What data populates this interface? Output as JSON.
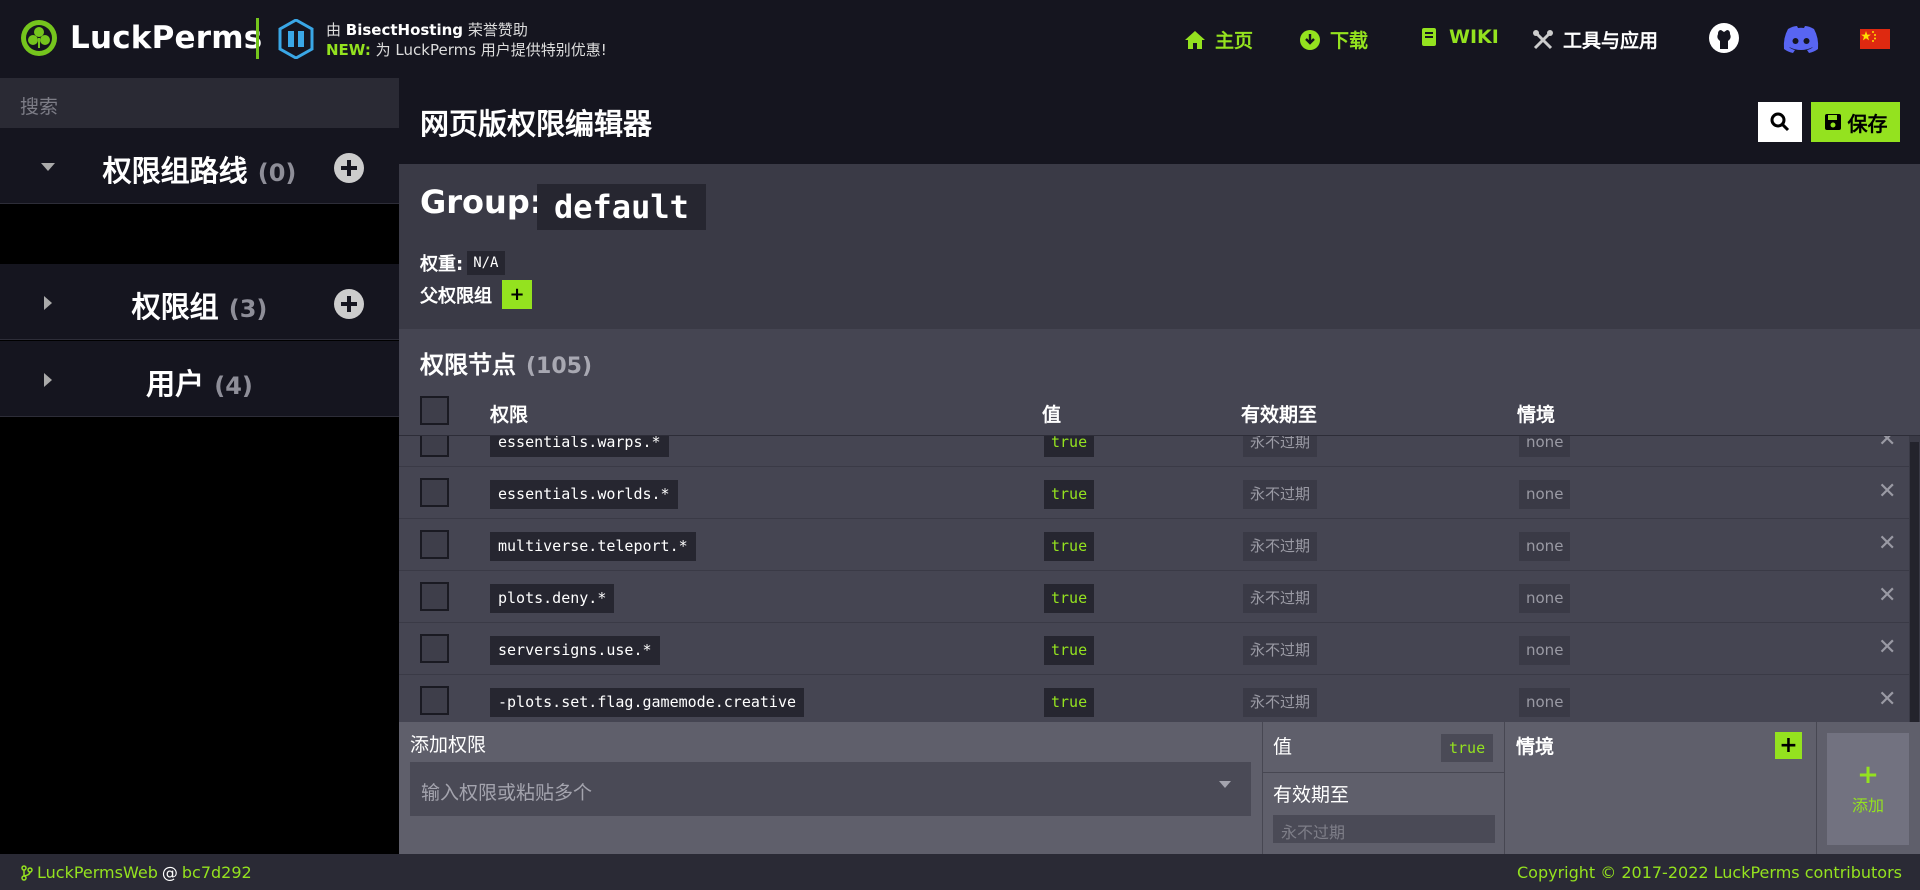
{
  "header": {
    "brand": "LuckPerms",
    "sponsor_prefix": "由 ",
    "sponsor_name": "BisectHosting",
    "sponsor_suffix": " 荣誉赞助",
    "sponsor_new_tag": "NEW:",
    "sponsor_new_text": " 为 LuckPerms 用户提供特别优惠!",
    "nav": {
      "home": "主页",
      "download": "下载",
      "wiki": "WIKI",
      "tools": "工具与应用"
    },
    "icons": [
      "home-icon",
      "download-icon",
      "book-icon",
      "tools-icon",
      "github-icon",
      "discord-icon",
      "china-flag-icon"
    ]
  },
  "sidebar": {
    "search_placeholder": "搜索",
    "sections": [
      {
        "label": "权限组路线",
        "count": "(0)"
      },
      {
        "label": "权限组",
        "count": "(3)"
      },
      {
        "label": "用户",
        "count": "(4)"
      }
    ]
  },
  "main": {
    "title": "网页版权限编辑器",
    "save_label": "保存",
    "group_label": "Group:",
    "group_name": "default",
    "weight_label": "权重:",
    "weight_value": "N/A",
    "parents_label": "父权限组",
    "parents_add": "+",
    "nodes_title": "权限节点",
    "nodes_count": "(105)",
    "columns": {
      "permission": "权限",
      "value": "值",
      "expiry": "有效期至",
      "context": "情境"
    },
    "rows": [
      {
        "permission": "essentials.warps.*",
        "value": "true",
        "expiry": "永不过期",
        "context": "none"
      },
      {
        "permission": "essentials.worlds.*",
        "value": "true",
        "expiry": "永不过期",
        "context": "none"
      },
      {
        "permission": "multiverse.teleport.*",
        "value": "true",
        "expiry": "永不过期",
        "context": "none"
      },
      {
        "permission": "plots.deny.*",
        "value": "true",
        "expiry": "永不过期",
        "context": "none"
      },
      {
        "permission": "serversigns.use.*",
        "value": "true",
        "expiry": "永不过期",
        "context": "none"
      },
      {
        "permission": "-plots.set.flag.gamemode.creative",
        "value": "true",
        "expiry": "永不过期",
        "context": "none"
      }
    ],
    "delete_glyph": "✕"
  },
  "add_bar": {
    "permission_label": "添加权限",
    "permission_placeholder": "输入权限或粘贴多个",
    "value_label": "值",
    "value_chip": "true",
    "expiry_label": "有效期至",
    "expiry_placeholder": "永不过期",
    "context_label": "情境",
    "context_add": "+",
    "add_plus": "+",
    "add_label": "添加"
  },
  "footer": {
    "app": "LuckPermsWeb",
    "at": "@",
    "commit": "bc7d292",
    "copyright": "Copyright © 2017-2022 LuckPerms contributors"
  },
  "colors": {
    "accent": "#94e21f",
    "header_bg": "#15151f",
    "panel_bg": "#3a3a46"
  }
}
